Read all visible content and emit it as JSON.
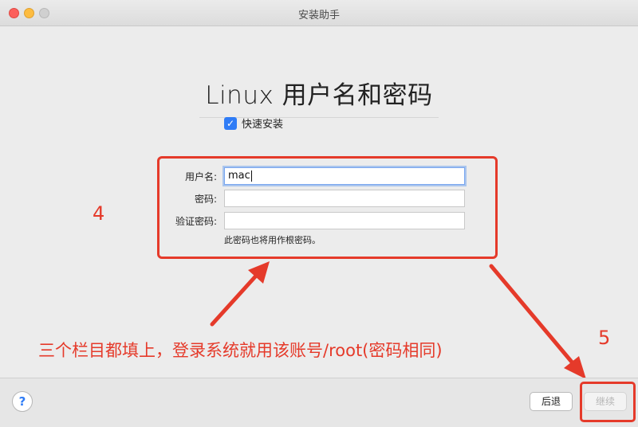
{
  "window": {
    "title": "安装助手"
  },
  "page": {
    "title": "Linux 用户名和密码"
  },
  "quick_install": {
    "checked": true,
    "label": "快速安装"
  },
  "form": {
    "username_label": "用户名:",
    "username_value": "mac",
    "password_label": "密码:",
    "password_value": "",
    "verify_label": "验证密码:",
    "verify_value": "",
    "note": "此密码也将用作根密码。"
  },
  "annotations": {
    "step4": "4",
    "step5": "5",
    "instruction": "三个栏目都填上，登录系统就用该账号/root(密码相同)",
    "color": "#e53a2a"
  },
  "footer": {
    "help_label": "?",
    "back_label": "后退",
    "continue_label": "继续"
  }
}
